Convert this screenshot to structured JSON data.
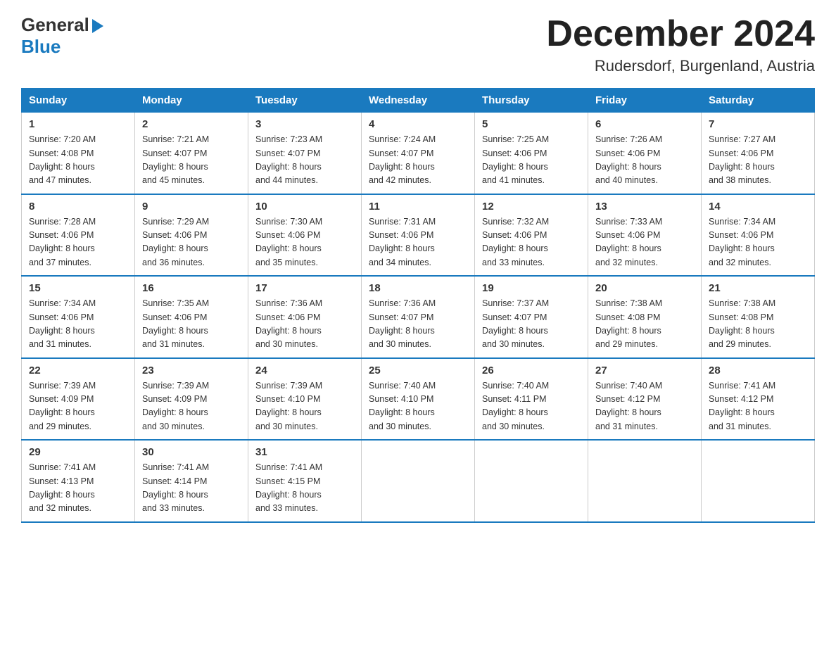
{
  "header": {
    "logo_general": "General",
    "logo_blue": "Blue",
    "month_title": "December 2024",
    "location": "Rudersdorf, Burgenland, Austria"
  },
  "calendar": {
    "days_of_week": [
      "Sunday",
      "Monday",
      "Tuesday",
      "Wednesday",
      "Thursday",
      "Friday",
      "Saturday"
    ],
    "weeks": [
      [
        {
          "day": "1",
          "sunrise": "7:20 AM",
          "sunset": "4:08 PM",
          "daylight": "8 hours and 47 minutes."
        },
        {
          "day": "2",
          "sunrise": "7:21 AM",
          "sunset": "4:07 PM",
          "daylight": "8 hours and 45 minutes."
        },
        {
          "day": "3",
          "sunrise": "7:23 AM",
          "sunset": "4:07 PM",
          "daylight": "8 hours and 44 minutes."
        },
        {
          "day": "4",
          "sunrise": "7:24 AM",
          "sunset": "4:07 PM",
          "daylight": "8 hours and 42 minutes."
        },
        {
          "day": "5",
          "sunrise": "7:25 AM",
          "sunset": "4:06 PM",
          "daylight": "8 hours and 41 minutes."
        },
        {
          "day": "6",
          "sunrise": "7:26 AM",
          "sunset": "4:06 PM",
          "daylight": "8 hours and 40 minutes."
        },
        {
          "day": "7",
          "sunrise": "7:27 AM",
          "sunset": "4:06 PM",
          "daylight": "8 hours and 38 minutes."
        }
      ],
      [
        {
          "day": "8",
          "sunrise": "7:28 AM",
          "sunset": "4:06 PM",
          "daylight": "8 hours and 37 minutes."
        },
        {
          "day": "9",
          "sunrise": "7:29 AM",
          "sunset": "4:06 PM",
          "daylight": "8 hours and 36 minutes."
        },
        {
          "day": "10",
          "sunrise": "7:30 AM",
          "sunset": "4:06 PM",
          "daylight": "8 hours and 35 minutes."
        },
        {
          "day": "11",
          "sunrise": "7:31 AM",
          "sunset": "4:06 PM",
          "daylight": "8 hours and 34 minutes."
        },
        {
          "day": "12",
          "sunrise": "7:32 AM",
          "sunset": "4:06 PM",
          "daylight": "8 hours and 33 minutes."
        },
        {
          "day": "13",
          "sunrise": "7:33 AM",
          "sunset": "4:06 PM",
          "daylight": "8 hours and 32 minutes."
        },
        {
          "day": "14",
          "sunrise": "7:34 AM",
          "sunset": "4:06 PM",
          "daylight": "8 hours and 32 minutes."
        }
      ],
      [
        {
          "day": "15",
          "sunrise": "7:34 AM",
          "sunset": "4:06 PM",
          "daylight": "8 hours and 31 minutes."
        },
        {
          "day": "16",
          "sunrise": "7:35 AM",
          "sunset": "4:06 PM",
          "daylight": "8 hours and 31 minutes."
        },
        {
          "day": "17",
          "sunrise": "7:36 AM",
          "sunset": "4:06 PM",
          "daylight": "8 hours and 30 minutes."
        },
        {
          "day": "18",
          "sunrise": "7:36 AM",
          "sunset": "4:07 PM",
          "daylight": "8 hours and 30 minutes."
        },
        {
          "day": "19",
          "sunrise": "7:37 AM",
          "sunset": "4:07 PM",
          "daylight": "8 hours and 30 minutes."
        },
        {
          "day": "20",
          "sunrise": "7:38 AM",
          "sunset": "4:08 PM",
          "daylight": "8 hours and 29 minutes."
        },
        {
          "day": "21",
          "sunrise": "7:38 AM",
          "sunset": "4:08 PM",
          "daylight": "8 hours and 29 minutes."
        }
      ],
      [
        {
          "day": "22",
          "sunrise": "7:39 AM",
          "sunset": "4:09 PM",
          "daylight": "8 hours and 29 minutes."
        },
        {
          "day": "23",
          "sunrise": "7:39 AM",
          "sunset": "4:09 PM",
          "daylight": "8 hours and 30 minutes."
        },
        {
          "day": "24",
          "sunrise": "7:39 AM",
          "sunset": "4:10 PM",
          "daylight": "8 hours and 30 minutes."
        },
        {
          "day": "25",
          "sunrise": "7:40 AM",
          "sunset": "4:10 PM",
          "daylight": "8 hours and 30 minutes."
        },
        {
          "day": "26",
          "sunrise": "7:40 AM",
          "sunset": "4:11 PM",
          "daylight": "8 hours and 30 minutes."
        },
        {
          "day": "27",
          "sunrise": "7:40 AM",
          "sunset": "4:12 PM",
          "daylight": "8 hours and 31 minutes."
        },
        {
          "day": "28",
          "sunrise": "7:41 AM",
          "sunset": "4:12 PM",
          "daylight": "8 hours and 31 minutes."
        }
      ],
      [
        {
          "day": "29",
          "sunrise": "7:41 AM",
          "sunset": "4:13 PM",
          "daylight": "8 hours and 32 minutes."
        },
        {
          "day": "30",
          "sunrise": "7:41 AM",
          "sunset": "4:14 PM",
          "daylight": "8 hours and 33 minutes."
        },
        {
          "day": "31",
          "sunrise": "7:41 AM",
          "sunset": "4:15 PM",
          "daylight": "8 hours and 33 minutes."
        },
        null,
        null,
        null,
        null
      ]
    ],
    "labels": {
      "sunrise": "Sunrise:",
      "sunset": "Sunset:",
      "daylight": "Daylight:"
    }
  }
}
